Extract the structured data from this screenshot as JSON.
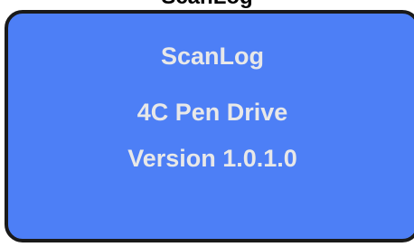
{
  "top_title": "ScanLog",
  "display": {
    "line1": "ScanLog",
    "line2": "4C Pen Drive",
    "line3": "Version 1.0.1.0"
  },
  "colors": {
    "panel_background": "#4d7ff6",
    "panel_border": "#1a1a1a",
    "text": "#e8e8e8"
  }
}
